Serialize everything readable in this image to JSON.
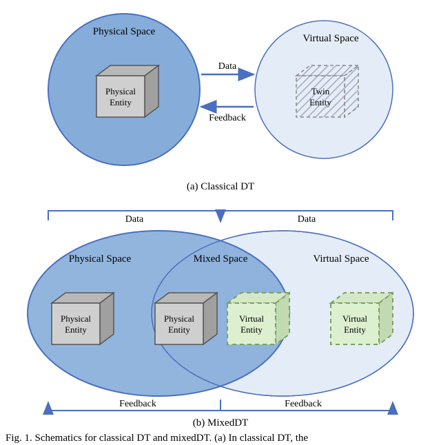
{
  "panelA": {
    "physicalSpaceLabel": "Physical Space",
    "virtualSpaceLabel": "Virtual Space",
    "physicalEntityLine1": "Physical",
    "physicalEntityLine2": "Entity",
    "twinEntityLine1": "Twin",
    "twinEntityLine2": "Entity",
    "dataLabel": "Data",
    "feedbackLabel": "Feedback",
    "caption": "(a) Classical DT"
  },
  "panelB": {
    "physicalSpaceLabel": "Physical Space",
    "mixedSpaceLabel": "Mixed Space",
    "virtualSpaceLabel": "Virtual Space",
    "physicalEntityLine1": "Physical",
    "physicalEntityLine2": "Entity",
    "virtualEntityLine1": "Virtual",
    "virtualEntityLine2": "Entity",
    "dataLabel1": "Data",
    "dataLabel2": "Data",
    "feedbackLabel1": "Feedback",
    "feedbackLabel2": "Feedback",
    "caption": "(b) MixedDT"
  },
  "figureCaption": "Fig. 1.   Schematics for classical DT and mixedDT. (a) In classical DT, the"
}
